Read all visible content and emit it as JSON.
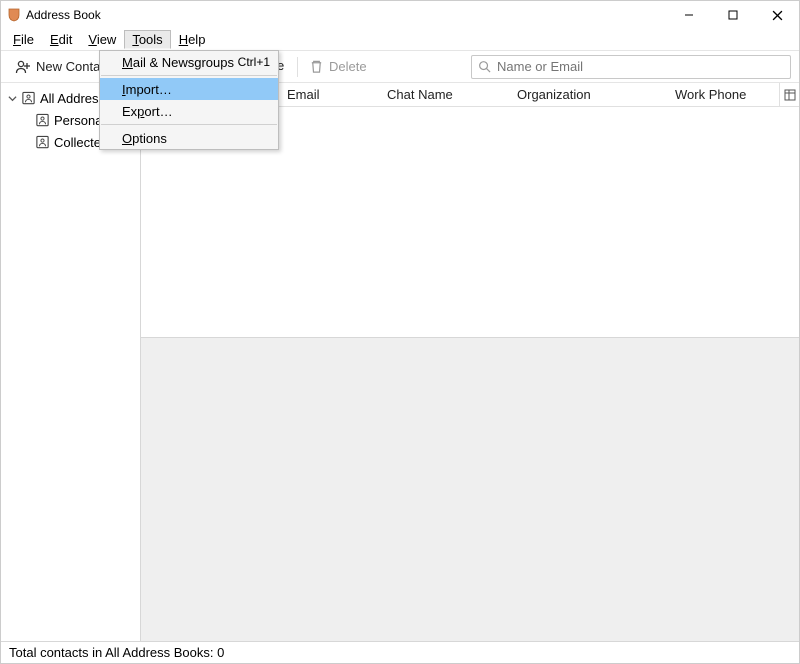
{
  "titlebar": {
    "title": "Address Book"
  },
  "menubar": {
    "file": "File",
    "edit": "Edit",
    "view": "View",
    "tools": "Tools",
    "help": "Help"
  },
  "tools_menu": {
    "mail_newsgroups": "Mail & Newsgroups",
    "mail_newsgroups_shortcut": "Ctrl+1",
    "import": "Import…",
    "export": "Export…",
    "options": "Options"
  },
  "toolbar": {
    "new_contact": "New Contact",
    "e_suffix": "e",
    "delete": "Delete"
  },
  "search": {
    "placeholder": "Name or Email"
  },
  "sidebar": {
    "root": "All Address",
    "items": [
      "Persona.",
      "Collecte."
    ]
  },
  "columns": {
    "name": "",
    "email": "Email",
    "chat": "Chat Name",
    "org": "Organization",
    "work": "Work Phone"
  },
  "status": {
    "text": "Total contacts in All Address Books: 0"
  }
}
